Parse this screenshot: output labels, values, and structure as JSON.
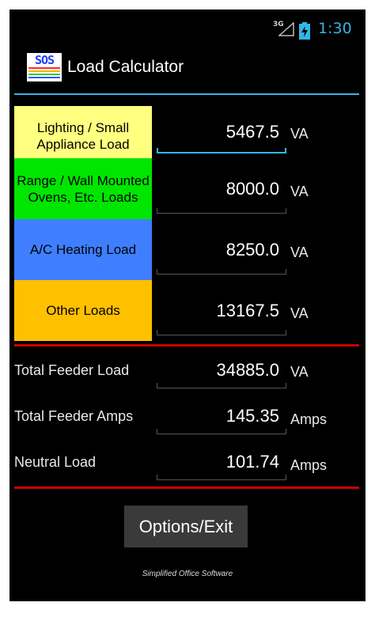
{
  "status_bar": {
    "network": "3G",
    "time": "1:30",
    "time_color": "#33b5e5"
  },
  "app": {
    "logo_text": "SOS",
    "title": "Load Calculator"
  },
  "loads": [
    {
      "label": "Lighting / Small Appliance Load",
      "value": "5467.5",
      "unit": "VA",
      "color": "#ffff80"
    },
    {
      "label": "Range / Wall Mounted Ovens, Etc. Loads",
      "value": "8000.0",
      "unit": "VA",
      "color": "#00e600"
    },
    {
      "label": "A/C Heating Load",
      "value": "8250.0",
      "unit": "VA",
      "color": "#3f7fff"
    },
    {
      "label": "Other Loads",
      "value": "13167.5",
      "unit": "VA",
      "color": "#ffc000"
    }
  ],
  "totals": [
    {
      "label": "Total Feeder Load",
      "value": "34885.0",
      "unit": "VA"
    },
    {
      "label": "Total Feeder Amps",
      "value": "145.35",
      "unit": "Amps"
    },
    {
      "label": "Neutral Load",
      "value": "101.74",
      "unit": "Amps"
    }
  ],
  "options_button": "Options/Exit",
  "footer": "Simplified Office Software"
}
